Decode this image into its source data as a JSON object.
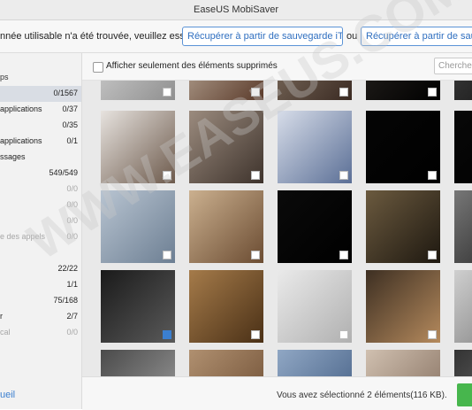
{
  "window": {
    "title": "EaseUS MobiSaver"
  },
  "infobar": {
    "message": "nnée utilisable n'a été trouvée, veuillez essayez",
    "itunes_button": "Récupérer à partir de sauvegarde iTunes",
    "or": "ou",
    "icloud_button": "Récupérer à partir de sauvegarde iCloud"
  },
  "sidebar": {
    "header": "ps",
    "items": [
      {
        "label": "",
        "count": "0/1567",
        "selected": true,
        "dim": false
      },
      {
        "label": "applications",
        "count": "0/37",
        "dim": false
      },
      {
        "label": "",
        "count": "0/35",
        "dim": false
      },
      {
        "label": "applications",
        "count": "0/1",
        "dim": false
      },
      {
        "label": "ssages",
        "count": "",
        "dim": false
      },
      {
        "label": "",
        "count": "549/549",
        "dim": false
      },
      {
        "label": "",
        "count": "0/0",
        "dim": true
      },
      {
        "label": "",
        "count": "0/0",
        "dim": true
      },
      {
        "label": "",
        "count": "0/0",
        "dim": true
      },
      {
        "label": "e des appels",
        "count": "0/0",
        "dim": true
      },
      {
        "label": "",
        "count": "",
        "dim": false
      },
      {
        "label": "",
        "count": "22/22",
        "dim": false
      },
      {
        "label": "",
        "count": "1/1",
        "dim": false
      },
      {
        "label": "",
        "count": "75/168",
        "dim": false
      },
      {
        "label": "r",
        "count": "2/7",
        "dim": false
      },
      {
        "label": "cal",
        "count": "0/0",
        "dim": true
      }
    ],
    "bottom_link": "ueil"
  },
  "toolbar": {
    "show_deleted_label": "Afficher seulement des éléments supprimés",
    "search_placeholder": "Cherche"
  },
  "thumbnails": [
    {
      "colors": [
        "#d9d9d9",
        "#8f8f8f"
      ],
      "checked": false
    },
    {
      "colors": [
        "#c7b9a8",
        "#5a3a2a"
      ],
      "checked": false
    },
    {
      "colors": [
        "#8a7a6a",
        "#3a2a22"
      ],
      "checked": false
    },
    {
      "colors": [
        "#2a2622",
        "#000000"
      ],
      "checked": false
    },
    {
      "colors": [
        "#444",
        "#111"
      ],
      "checked": false
    },
    {
      "colors": [
        "#e7e3df",
        "#6d5a4c"
      ],
      "checked": false
    },
    {
      "colors": [
        "#9b8b7e",
        "#3e332c"
      ],
      "checked": false
    },
    {
      "colors": [
        "#d7dde9",
        "#5b6f96"
      ],
      "checked": false
    },
    {
      "colors": [
        "#050505",
        "#000000"
      ],
      "checked": false
    },
    {
      "colors": [
        "#080808",
        "#000000"
      ],
      "checked": false
    },
    {
      "colors": [
        "#b8c4d1",
        "#6d7f93"
      ],
      "checked": false
    },
    {
      "colors": [
        "#cbb08f",
        "#6b4c32"
      ],
      "checked": false
    },
    {
      "colors": [
        "#0a0a0a",
        "#000000"
      ],
      "checked": false
    },
    {
      "colors": [
        "#6b5a3f",
        "#1e1810"
      ],
      "checked": false
    },
    {
      "colors": [
        "#777",
        "#222"
      ],
      "checked": false
    },
    {
      "colors": [
        "#1a1a1a",
        "#5a5a5a"
      ],
      "checked": true
    },
    {
      "colors": [
        "#a57b4a",
        "#4a3016"
      ],
      "checked": false
    },
    {
      "colors": [
        "#eaeaea",
        "#b0b0b0"
      ],
      "checked": false
    },
    {
      "colors": [
        "#3d2f22",
        "#b58a5d"
      ],
      "checked": false
    },
    {
      "colors": [
        "#cfcfcf",
        "#7a7a7a"
      ],
      "checked": false
    },
    {
      "colors": [
        "#4a4a4a",
        "#a0a0a0"
      ],
      "checked": false
    },
    {
      "colors": [
        "#b09070",
        "#6a4a30"
      ],
      "checked": false
    },
    {
      "colors": [
        "#90a7c4",
        "#3f5a80"
      ],
      "checked": false
    },
    {
      "colors": [
        "#d0c0b0",
        "#806a5a"
      ],
      "checked": false
    },
    {
      "colors": [
        "#333",
        "#777"
      ],
      "checked": false
    }
  ],
  "footer": {
    "status": "Vous avez sélectionné 2 éléments(116 KB).",
    "recover_label": ""
  },
  "watermark": "WWW.EASEUS.COM"
}
